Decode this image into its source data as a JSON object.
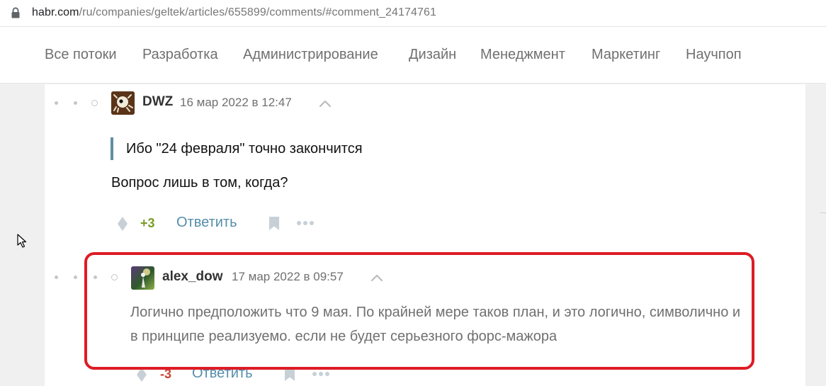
{
  "browser": {
    "url_host": "habr.com",
    "url_path": "/ru/companies/geltek/articles/655899/comments/#comment_24174761"
  },
  "topnav": {
    "items": [
      "Все потоки",
      "Разработка",
      "Администрирование",
      "Дизайн",
      "Менеджмент",
      "Маркетинг",
      "Научпоп"
    ]
  },
  "comments": [
    {
      "username": "DWZ",
      "date": "16 мар 2022 в 12:47",
      "quote": "Ибо \"24 февраля\" точно закончится",
      "text": "Вопрос лишь в том, когда?",
      "score": "+3",
      "reply_label": "Ответить"
    },
    {
      "username": "alex_dow",
      "date": "17 мар 2022 в 09:57",
      "text": "Логично предположить что 9 мая. По крайней мере таков план, и это логично, символично и в принципе реализуемо. если не будет серьезного форс-мажора",
      "score": "-3",
      "reply_label": "Ответить"
    }
  ],
  "colors": {
    "highlight": "#dd1c25",
    "positive": "#7b9b24",
    "negative": "#cc4436",
    "link": "#548eaa",
    "quote_bar": "#5e8ea5"
  },
  "icons": [
    "lock-icon",
    "avatar-dwz",
    "avatar-alex-dow",
    "caret-up-icon",
    "vote-icon",
    "bookmark-icon",
    "more-icon",
    "mouse-cursor-icon"
  ]
}
